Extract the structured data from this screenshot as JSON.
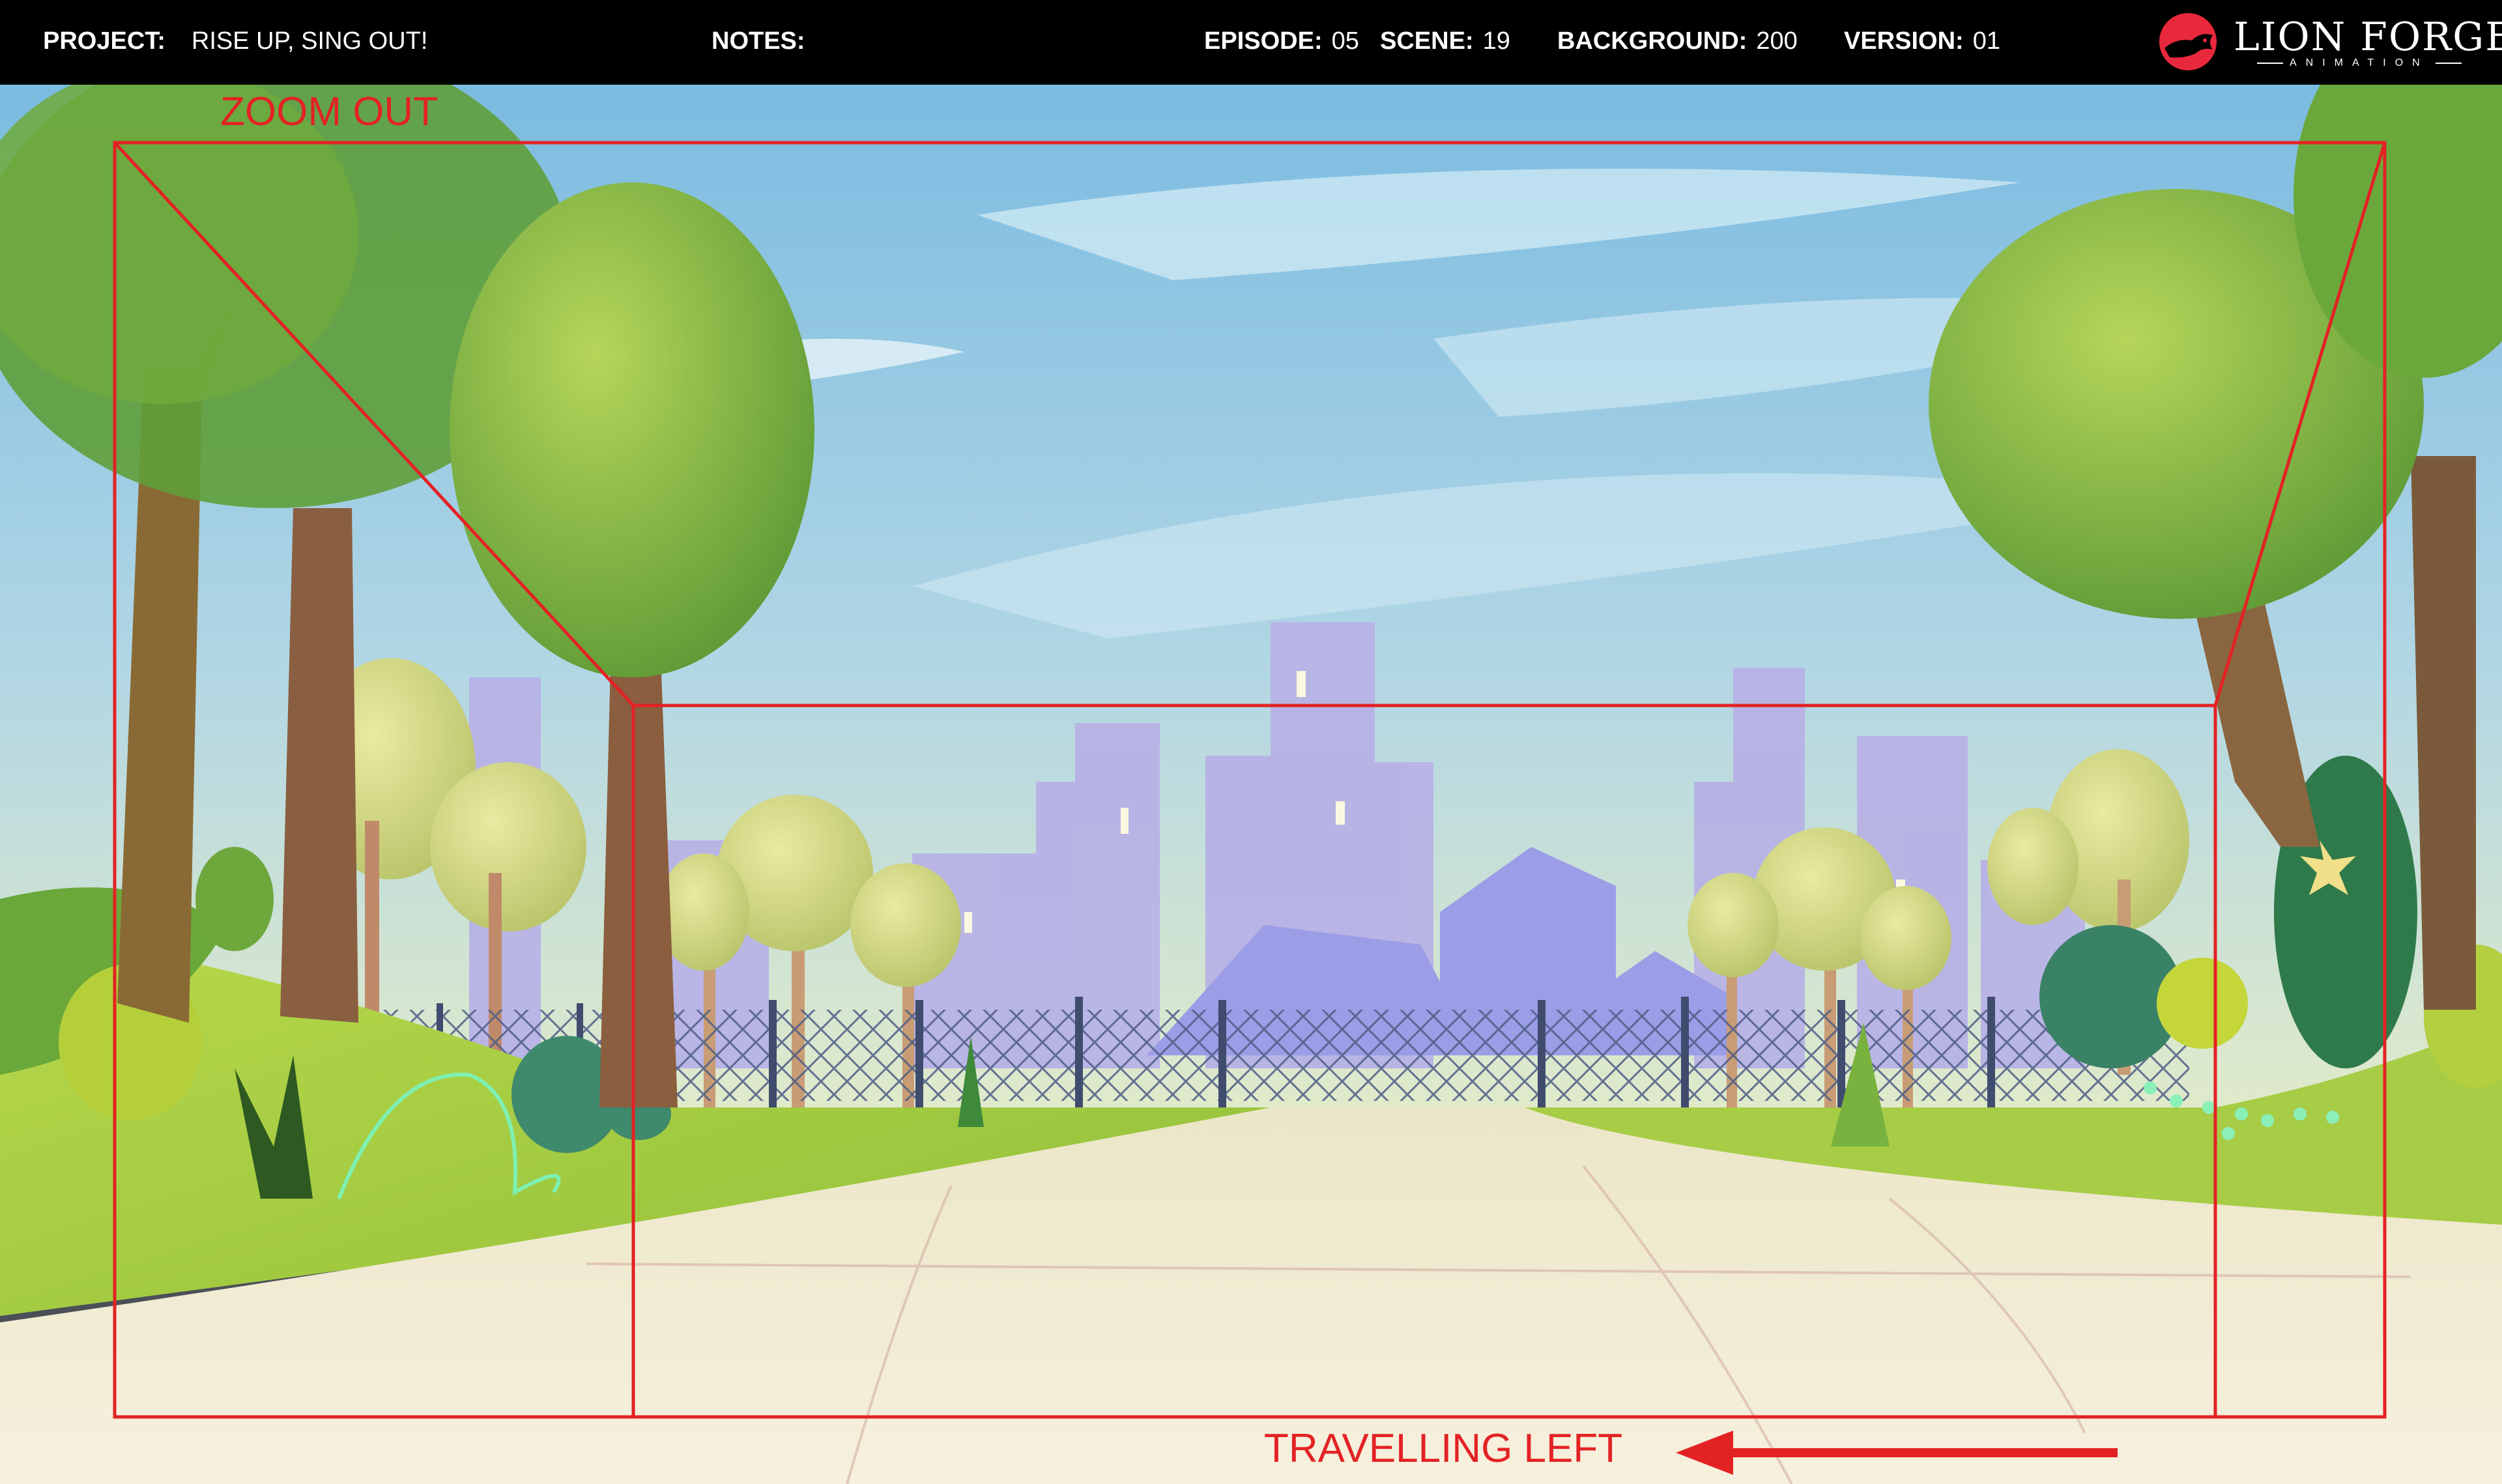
{
  "header": {
    "project_label": "PROJECT:",
    "project_value": "RISE UP, SING OUT!",
    "notes_label": "NOTES:",
    "notes_value": "",
    "episode_label": "EPISODE:",
    "episode_value": "05",
    "scene_label": "SCENE:",
    "scene_value": "19",
    "background_label": "BACKGROUND:",
    "background_value": "200",
    "version_label": "VERSION:",
    "version_value": "01"
  },
  "logo": {
    "name": "LION FORGE",
    "subtitle": "ANIMATION",
    "icon": "lion-head-icon",
    "color": "#e8283c"
  },
  "annotations": {
    "zoom_out": "ZOOM OUT",
    "travelling_left": "TRAVELLING LEFT",
    "color": "#e32224"
  }
}
